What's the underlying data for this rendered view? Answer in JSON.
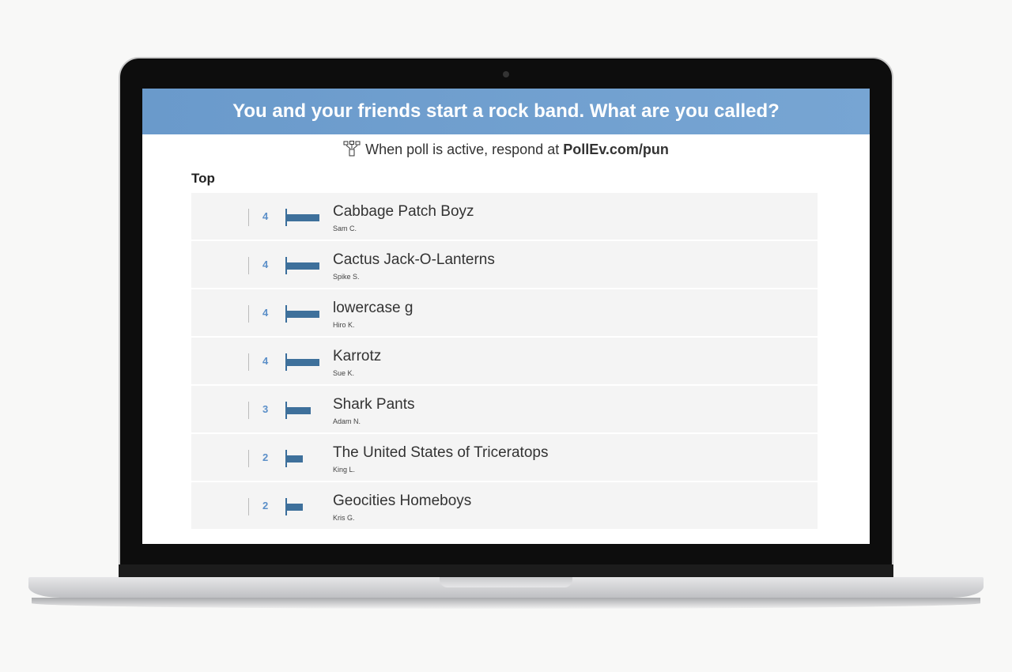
{
  "poll": {
    "question": "You and your friends start a rock band. What are you called?",
    "instruction_prefix": "When poll is active, respond at ",
    "instruction_url": "PollEv.com/pun",
    "section_label": "Top",
    "accent_color": "#6a9acb",
    "bar_color": "#3e709b",
    "responses": [
      {
        "text": "Cabbage Patch Boyz",
        "author": "Sam C.",
        "votes": 4
      },
      {
        "text": "Cactus Jack-O-Lanterns",
        "author": "Spike S.",
        "votes": 4
      },
      {
        "text": "lowercase g",
        "author": "Hiro K.",
        "votes": 4
      },
      {
        "text": "Karrotz",
        "author": "Sue K.",
        "votes": 4
      },
      {
        "text": "Shark Pants",
        "author": "Adam N.",
        "votes": 3
      },
      {
        "text": "The United States of Triceratops",
        "author": "King L.",
        "votes": 2
      },
      {
        "text": "Geocities Homeboys",
        "author": "Kris G.",
        "votes": 2
      }
    ]
  }
}
